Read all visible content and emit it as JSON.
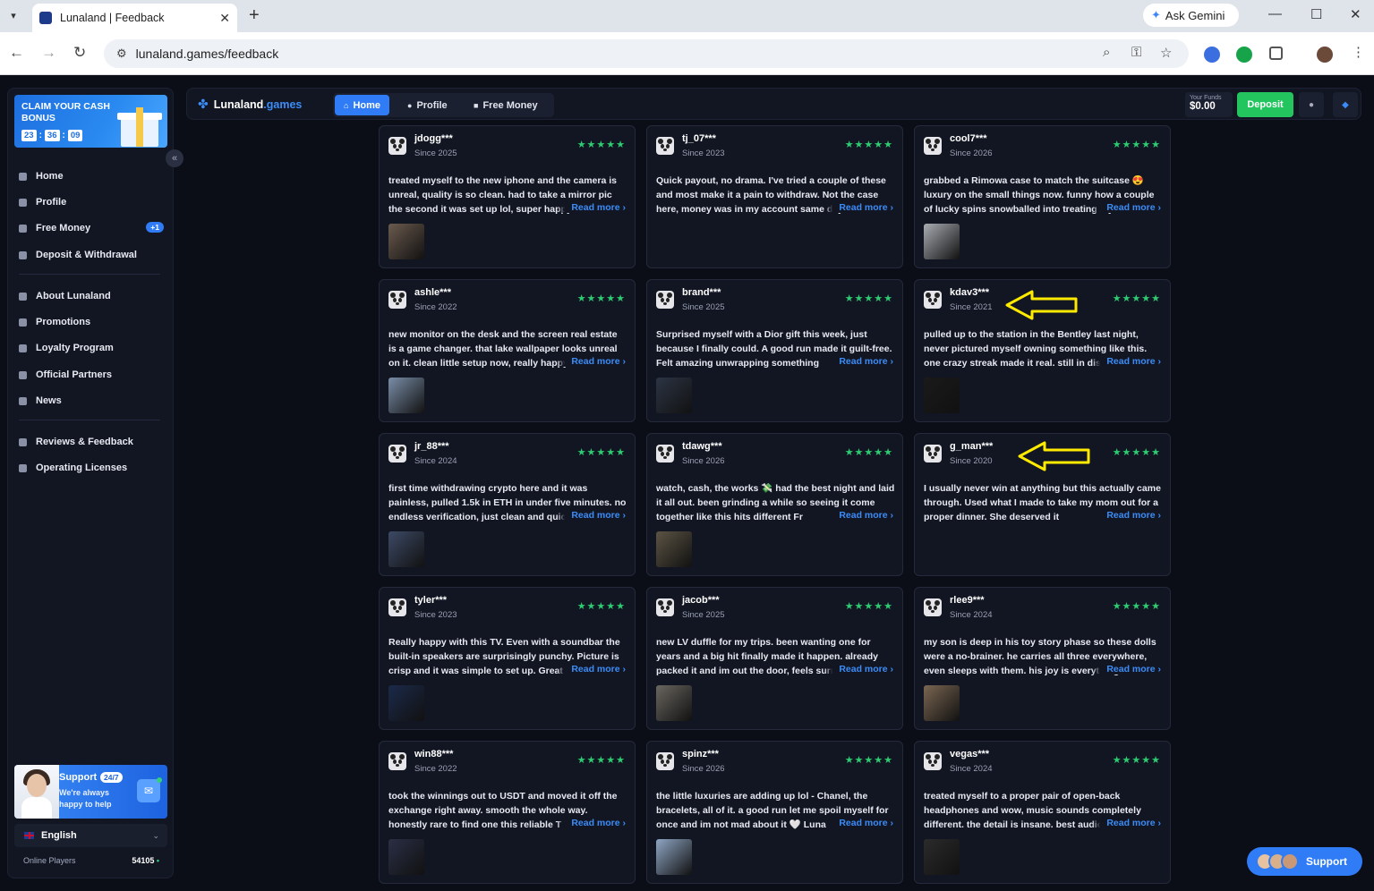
{
  "browser": {
    "tab_title": "Lunaland | Feedback",
    "url": "lunaland.games/feedback",
    "gemini_label": "Ask Gemini"
  },
  "sidebar": {
    "bonus": {
      "title": "CLAIM YOUR CASH BONUS",
      "timer": [
        "23",
        "36",
        "09"
      ]
    },
    "items": [
      {
        "label": "Home",
        "icon": "home-icon"
      },
      {
        "label": "Profile",
        "icon": "user-icon"
      },
      {
        "label": "Free Money",
        "icon": "gift-icon",
        "badge": "+1"
      },
      {
        "label": "Deposit & Withdrawal",
        "icon": "wallet-icon"
      },
      {
        "label": "About Lunaland",
        "icon": "info-icon"
      },
      {
        "label": "Promotions",
        "icon": "tag-icon"
      },
      {
        "label": "Loyalty Program",
        "icon": "trophy-icon"
      },
      {
        "label": "Official Partners",
        "icon": "handshake-icon"
      },
      {
        "label": "News",
        "icon": "megaphone-icon"
      },
      {
        "label": "Reviews & Feedback",
        "icon": "chat-icon"
      },
      {
        "label": "Operating Licenses",
        "icon": "shield-icon"
      }
    ],
    "support": {
      "title": "Support",
      "badge": "24/7",
      "subtitle": "We're always happy to help"
    },
    "language": "English",
    "online_label": "Online Players",
    "online_count": "54105"
  },
  "topbar": {
    "logo_name": "Lunaland",
    "logo_tld": ".games",
    "nav": [
      "Home",
      "Profile",
      "Free Money"
    ],
    "funds_label": "Your Funds",
    "funds_value": "$0.00",
    "deposit_label": "Deposit"
  },
  "reviews": [
    {
      "user": "jdogg***",
      "since": "Since 2025",
      "stars": "★★★★★",
      "text": "treated myself to the new iphone and the camera is unreal, quality is so clean. had to take a mirror pic the second it was set up lol, super happy",
      "read_more": "Read more ›",
      "thumb": "#6b5a4e"
    },
    {
      "user": "tj_07***",
      "since": "Since 2023",
      "stars": "★★★★★",
      "text": "Quick payout, no drama. I've tried a couple of these and most make it a pain to withdraw. Not the case here, money was in my account same day",
      "read_more": "Read more ›",
      "thumb": ""
    },
    {
      "user": "cool7***",
      "since": "Since 2026",
      "stars": "★★★★★",
      "text": "grabbed a Rimowa case to match the suitcase 😍 luxury on the small things now. funny how a couple of lucky spins snowballed into treating myself",
      "read_more": "Read more ›",
      "thumb": "#a9acb2"
    },
    {
      "user": "ashle***",
      "since": "Since 2022",
      "stars": "★★★★★",
      "text": "new monitor on the desk and the screen real estate is a game changer. that lake wallpaper looks unreal on it. clean little setup now, really happy",
      "read_more": "Read more ›",
      "thumb": "#7a8ea8"
    },
    {
      "user": "brand***",
      "since": "Since 2025",
      "stars": "★★★★★",
      "text": "Surprised myself with a Dior gift this week, just because I finally could. A good run made it guilt-free. Felt amazing unwrapping something",
      "read_more": "Read more ›",
      "thumb": "#2c3444"
    },
    {
      "user": "kdav3***",
      "since": "Since 2021",
      "stars": "★★★★★",
      "text": "pulled up to the station in the Bentley last night, never pictured myself owning something like this. one crazy streak made it real. still in disbelief",
      "read_more": "Read more ›",
      "thumb": "#1a1a1a"
    },
    {
      "user": "jr_88***",
      "since": "Since 2024",
      "stars": "★★★★★",
      "text": "first time withdrawing crypto here and it was painless, pulled 1.5k in ETH in under five minutes. no endless verification, just clean and quick",
      "read_more": "Read more ›",
      "thumb": "#3d4a66"
    },
    {
      "user": "tdawg***",
      "since": "Since 2026",
      "stars": "★★★★★",
      "text": "watch, cash, the works 💸 had the best night and laid it all out. been grinding a while so seeing it come together like this hits different Fr",
      "read_more": "Read more ›",
      "thumb": "#5c5444"
    },
    {
      "user": "g_man***",
      "since": "Since 2020",
      "stars": "★★★★★",
      "text": "I usually never win at anything but this actually came through. Used what I made to take my mom out for a proper dinner. She deserved it",
      "read_more": "Read more ›",
      "thumb": ""
    },
    {
      "user": "tyler***",
      "since": "Since 2023",
      "stars": "★★★★★",
      "text": "Really happy with this TV. Even with a soundbar the built-in speakers are surprisingly punchy. Picture is crisp and it was simple to set up. Great",
      "read_more": "Read more ›",
      "thumb": "#1b2a4a"
    },
    {
      "user": "jacob***",
      "since": "Since 2025",
      "stars": "★★★★★",
      "text": "new LV duffle for my trips. been wanting one for years and a big hit finally made it happen. already packed it and im out the door, feels surreal",
      "read_more": "Read more ›",
      "thumb": "#6a6660"
    },
    {
      "user": "rlee9***",
      "since": "Since 2024",
      "stars": "★★★★★",
      "text": "my son is deep in his toy story phase so these dolls were a no-brainer. he carries all three everywhere, even sleeps with them. his joy is everything",
      "read_more": "Read more ›",
      "thumb": "#7a6652"
    },
    {
      "user": "win88***",
      "since": "Since 2022",
      "stars": "★★★★★",
      "text": "took the winnings out to USDT and moved it off the exchange right away. smooth the whole way. honestly rare to find one this reliable T",
      "read_more": "Read more ›",
      "thumb": "#2a2f45"
    },
    {
      "user": "spinz***",
      "since": "Since 2026",
      "stars": "★★★★★",
      "text": "the little luxuries are adding up lol - Chanel, the bracelets, all of it. a good run let me spoil myself for once and im not mad about it 🤍 Luna",
      "read_more": "Read more ›",
      "thumb": "#8fa6c4"
    },
    {
      "user": "vegas***",
      "since": "Since 2024",
      "stars": "★★★★★",
      "text": "treated myself to a proper pair of open-back headphones and wow, music sounds completely different. the detail is insane. best audio",
      "read_more": "Read more ›",
      "thumb": "#2b2b2b"
    }
  ],
  "float_support": "Support",
  "colors": {
    "accent": "#2f7cf6",
    "deposit": "#22c55e",
    "stars": "#2ecc71",
    "annotation_arrow": "#ffea00"
  }
}
